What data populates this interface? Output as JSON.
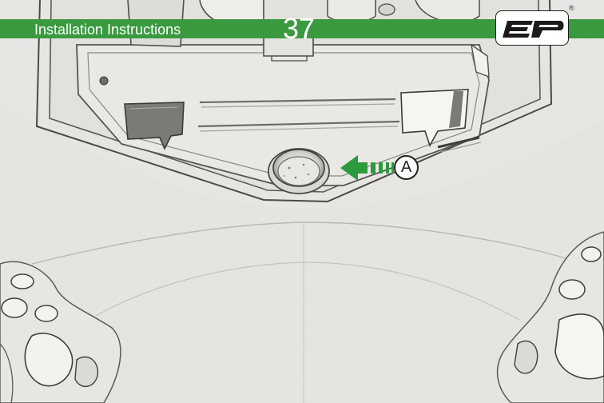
{
  "header": {
    "title": "Installation Instructions",
    "page_number": "37",
    "band_color": "#3a9a40"
  },
  "logo": {
    "lettering": "EP",
    "registered_mark": "®"
  },
  "callout": {
    "label": "A",
    "arrow_color": "#2e9a3e",
    "icon": "arrow-left-icon"
  },
  "illustration": {
    "subject": "sketch-style line drawing of vehicle body panel with round plug"
  }
}
